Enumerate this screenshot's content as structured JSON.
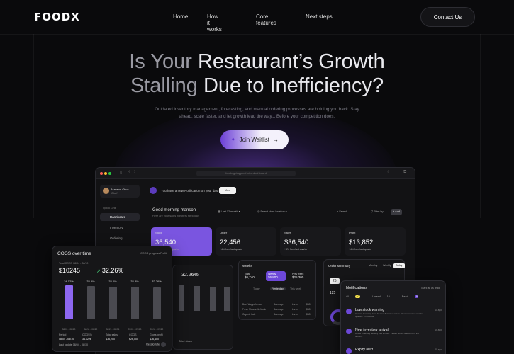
{
  "nav": {
    "logo": "FOODX",
    "links": [
      "Home",
      "How it works",
      "Core features",
      "Next steps"
    ],
    "cta": "Contact Us"
  },
  "hero": {
    "headline_line1_a": "Is Your ",
    "headline_line1_b": "Restaurant’s Growth",
    "headline_line2_a": "Stalling ",
    "headline_line2_b": "Due to Inefficiency?",
    "subtitle": "Outdated inventory management, forecasting, and manual ordering processes are holding you back. Stay ahead, scale faster, and let growth lead the way... Before your competition does.",
    "button": "Join Waitlist"
  },
  "dashboard": {
    "url": "foodx.getapptechnics.dashboard",
    "user_name": "Manson Olivo",
    "user_role": "Chef",
    "section_label": "Quick Link",
    "menu": [
      "Dashboard",
      "Inventory",
      "Ordering"
    ],
    "notice": "You have a new Notification on your dashboard!",
    "notice_button": "View message",
    "greeting": "Good morning manson",
    "greeting_sub": "Here are your sales numbers for today",
    "period": "Last 12 month",
    "location": "Select store location",
    "search": "Search",
    "filter": "Filter by",
    "add": "Add",
    "cards": [
      {
        "title": "Stock",
        "value": "36,540",
        "change": "+ 4% from last quarter"
      },
      {
        "title": "Order",
        "value": "22,456",
        "change": "+4% from last quarter"
      },
      {
        "title": "Sales",
        "value": "$36,540",
        "change": "+4% from last quarter"
      },
      {
        "title": "Profit",
        "value": "$13,852",
        "change": "+4% from last quarter"
      }
    ]
  },
  "cogs": {
    "title": "COGS over time",
    "selector": "COGS progress Profit",
    "total_label": "Total COGS 08/04 - 08/10",
    "total": "$10245",
    "change": "32.26%",
    "bars": [
      {
        "label": "34.12%",
        "value": 34.12,
        "date": "08/01 - 08/10",
        "highlight": true
      },
      {
        "label": "33.5%",
        "value": 33.5,
        "date": "08/11 - 08/20",
        "highlight": false
      },
      {
        "label": "33.0%",
        "value": 33.0,
        "date": "08/21 - 08/31",
        "highlight": false
      },
      {
        "label": "32.8%",
        "value": 32.8,
        "date": "09/01 - 09/10",
        "highlight": false
      },
      {
        "label": "32.26%",
        "value": 32.26,
        "date": "09/11 - 09/20",
        "highlight": false
      }
    ],
    "table_headers": [
      "Period",
      "COGS%",
      "Total sales",
      "COGS",
      "Gross profit"
    ],
    "table_row": [
      "08/04 - 08/10",
      "34.12%",
      "$76,200",
      "$26,000",
      "$76,400"
    ],
    "footer": "Last update 08/04 - 08/10",
    "recalc": "Recalculate"
  },
  "mini": {
    "pct": "32.26%",
    "label": "Total stock"
  },
  "weeks": {
    "title": "Weeks",
    "pills": [
      {
        "label": "Total",
        "value": "$6,740"
      },
      {
        "label": "Weekly",
        "value": "$6,800"
      },
      {
        "label": "Prev week",
        "value": "$25,300"
      }
    ],
    "tabs": [
      "Today",
      "Yesterday",
      "This week"
    ],
    "rows": [
      [
        "Beef Wagyu for Aus",
        "Beverage",
        "Lorem",
        "$500"
      ],
      [
        "Fresh Mozzarella Mode",
        "Beverage",
        "Lorem",
        "$500"
      ],
      [
        "Organic Kale",
        "Beverage",
        "Lorem",
        "$500"
      ]
    ]
  },
  "order_summary": {
    "title": "Order summary",
    "segments": [
      "Monthly",
      "Weekly",
      "Today"
    ],
    "count_badge": "26",
    "count": "125"
  },
  "notifications": {
    "title": "Notifications",
    "mark": "Mark all as read",
    "tabs": [
      "All",
      "Unread",
      "Read"
    ],
    "badges": [
      "10",
      "10",
      "9"
    ],
    "items": [
      {
        "title": "Low stock warning",
        "desc": "Current inventory level for item Tomatoes is low. Recommended reorder quantity: 25 pounds",
        "time": "10 ago"
      },
      {
        "title": "New inventory arrival",
        "desc": "A new inventory delivery has arrived. Please review and confirm the delivery",
        "time": "15 ago"
      },
      {
        "title": "Expiry alert",
        "desc": "",
        "time": "20 ago"
      }
    ]
  },
  "colors": {
    "accent": "#7a55e0",
    "background": "#0a0a0c",
    "positive": "#4ade80"
  }
}
